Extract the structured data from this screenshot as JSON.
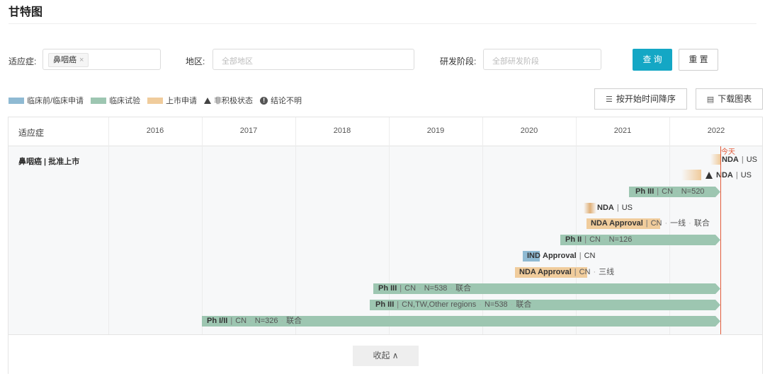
{
  "page": {
    "title": "甘特图"
  },
  "filters": {
    "indication_label": "适应症:",
    "indication_tag": "鼻咽癌",
    "indication_tag_close": "×",
    "region_label": "地区:",
    "region_placeholder": "全部地区",
    "stage_label": "研发阶段:",
    "stage_placeholder": "全部研发阶段",
    "query_button": "查 询",
    "reset_button": "重 置"
  },
  "legend": {
    "items": [
      {
        "label": "临床前/临床申请",
        "color": "#8fbad3"
      },
      {
        "label": "临床试验",
        "color": "#9dc6b1"
      },
      {
        "label": "上市申请",
        "color": "#f0cc9c"
      }
    ],
    "inactive_label": "非积极状态",
    "unclear_label": "结论不明"
  },
  "actions": {
    "sort_button": "按开始时间降序",
    "download_button": "下载图表"
  },
  "gantt": {
    "column_header": "适应症",
    "years": [
      "2016",
      "2017",
      "2018",
      "2019",
      "2020",
      "2021",
      "2022"
    ],
    "row_label": "鼻咽癌 | 批准上市",
    "today_label": "今天",
    "collapse_button": "收起 ∧",
    "bars": [
      {
        "main": "NDA",
        "region": "US"
      },
      {
        "main": "NDA",
        "region": "US"
      },
      {
        "main": "Ph III",
        "region": "CN",
        "note1": "N=520"
      },
      {
        "main": "NDA",
        "region": "US"
      },
      {
        "main": "NDA Approval",
        "region": "CN",
        "note1": "一线",
        "note2": "联合"
      },
      {
        "main": "Ph II",
        "region": "CN",
        "note1": "N=126"
      },
      {
        "main": "IND",
        "main2": "Approval",
        "region": "CN"
      },
      {
        "main": "NDA Approval",
        "region": "CN",
        "note1": "三线"
      },
      {
        "main": "Ph III",
        "region": "CN",
        "note1": "N=538",
        "note2": "联合"
      },
      {
        "main": "Ph III",
        "region": "CN,TW,Other regions",
        "note1": "N=538",
        "note2": "联合"
      },
      {
        "main": "Ph I/II",
        "region": "CN",
        "note1": "N=326",
        "note2": "联合"
      }
    ]
  }
}
